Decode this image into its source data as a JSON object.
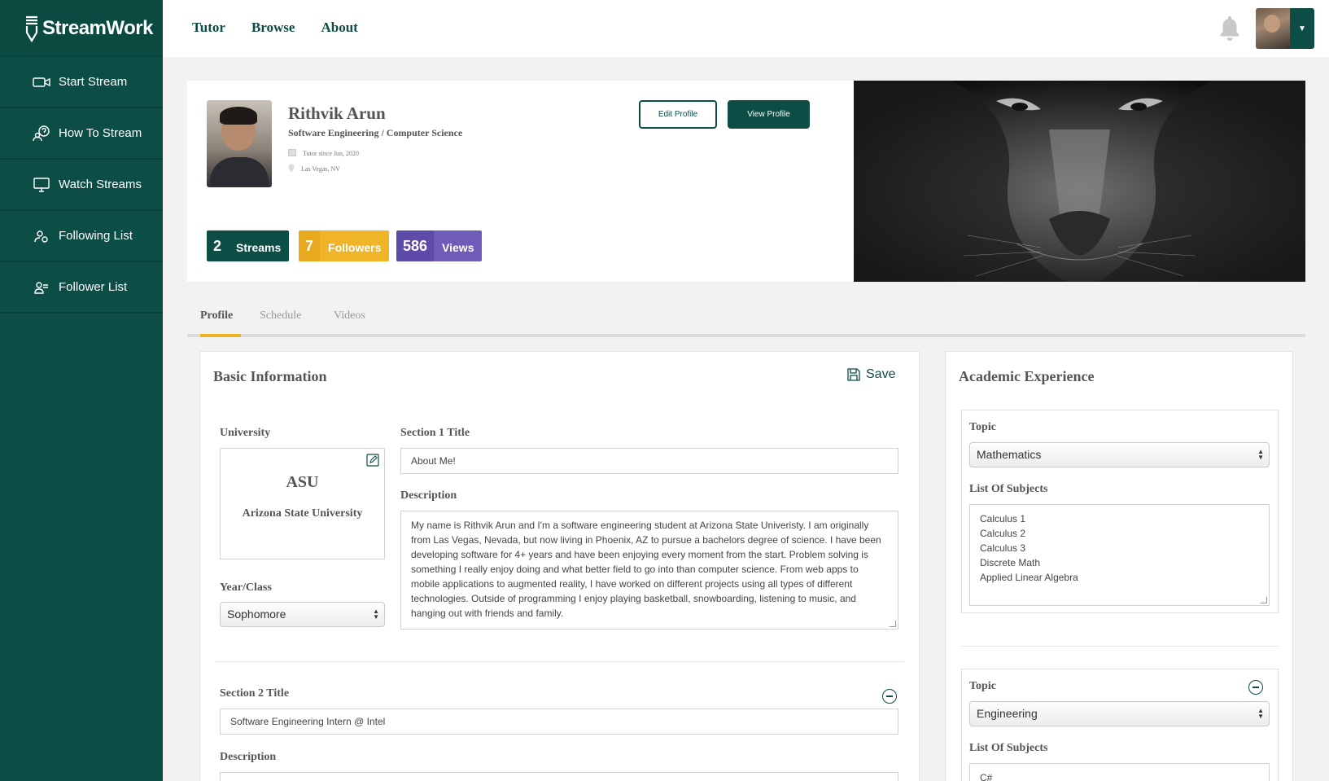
{
  "app": {
    "name": "StreamWork"
  },
  "sidebar": {
    "items": [
      {
        "label": "Start Stream",
        "icon": "video-camera-icon"
      },
      {
        "label": "How To Stream",
        "icon": "help-chat-icon"
      },
      {
        "label": "Watch Streams",
        "icon": "monitor-icon"
      },
      {
        "label": "Following List",
        "icon": "following-users-icon"
      },
      {
        "label": "Follower List",
        "icon": "follower-users-icon"
      }
    ]
  },
  "topnav": {
    "links": [
      "Tutor",
      "Browse",
      "About"
    ]
  },
  "profile": {
    "name": "Rithvik Arun",
    "major": "Software Engineering / Computer Science",
    "tutor_since": "Tutor since Jun, 2020",
    "location": "Las Vegas, NV",
    "edit_label": "Edit Profile",
    "view_label": "View Profile",
    "stats": [
      {
        "num": "2",
        "label": "Streams",
        "color": "#0c4d45"
      },
      {
        "num": "7",
        "label": "Followers",
        "color": "#f0b429"
      },
      {
        "num": "586",
        "label": "Views",
        "color": "#6f5bb8"
      }
    ]
  },
  "tabs": [
    "Profile",
    "Schedule",
    "Videos"
  ],
  "basic": {
    "title": "Basic Information",
    "save_label": "Save",
    "university_label": "University",
    "university_abbr": "ASU",
    "university_name": "Arizona State University",
    "year_label": "Year/Class",
    "year_value": "Sophomore",
    "section1_title_label": "Section 1 Title",
    "section1_title_value": "About Me!",
    "description_label": "Description",
    "description_value": "My name is Rithvik Arun and I'm a software engineering student at Arizona State Univeristy. I am originally from Las Vegas, Nevada, but now living in Phoenix, AZ to pursue a bachelors degree of science. I have been developing software for 4+ years and have been enjoying every moment from the start. Problem solving is something I really enjoy doing and what better field to go into than computer science. From web apps to mobile applications to augmented reality, I have worked on different projects using all types of different technologies. Outside of programming I enjoy playing basketball, snowboarding, listening to music, and hanging out with friends and family.",
    "section2_title_label": "Section 2 Title",
    "section2_title_value": "Software Engineering Intern @ Intel",
    "description2_label": "Description"
  },
  "academic": {
    "title": "Academic Experience",
    "topic_label": "Topic",
    "subjects_label": "List Of Subjects",
    "entries": [
      {
        "topic": "Mathematics",
        "subjects": [
          "Calculus 1",
          "Calculus 2",
          "Calculus 3",
          "Discrete Math",
          "Applied Linear Algebra"
        ]
      },
      {
        "topic": "Engineering",
        "subjects": [
          "C#"
        ]
      }
    ]
  }
}
